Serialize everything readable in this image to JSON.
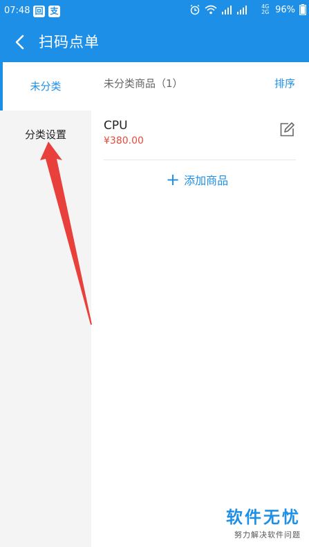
{
  "status_bar": {
    "time": "07:48",
    "app_icons": [
      "scan-app-icon",
      "alipay-icon"
    ],
    "app_icon_glyphs": [
      "回",
      "支"
    ],
    "network": "4G 2G",
    "battery": "96%"
  },
  "title_bar": {
    "title": "扫码点单",
    "back_icon": "chevron-left-icon"
  },
  "sidebar": {
    "items": [
      {
        "label": "未分类",
        "active": true
      },
      {
        "label": "分类设置",
        "active": false
      }
    ]
  },
  "main": {
    "section_title": "未分类商品（1）",
    "sort_label": "排序",
    "products": [
      {
        "name": "CPU",
        "price": "¥380.00",
        "edit_icon": "edit-icon"
      }
    ],
    "add_label": "添加商品"
  },
  "watermark": {
    "main": "软件无忧",
    "sub": "努力解决软件问题"
  },
  "colors": {
    "brand": "#1E8FE6",
    "price": "#e64a3b",
    "annotation_arrow": "#e8403a"
  }
}
